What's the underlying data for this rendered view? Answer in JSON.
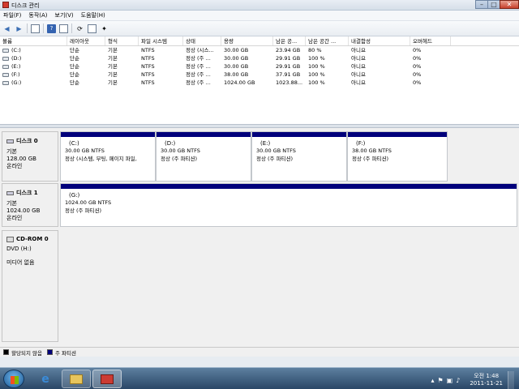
{
  "window": {
    "title": "디스크 관리",
    "min": "–",
    "max": "□",
    "close": "✕"
  },
  "menu": [
    {
      "label": "파일(F)"
    },
    {
      "label": "동작(A)"
    },
    {
      "label": "보기(V)"
    },
    {
      "label": "도움말(H)"
    }
  ],
  "toolbar": {
    "icons": [
      "back-arrow-icon",
      "forward-arrow-icon",
      "properties-icon",
      "help-icon",
      "list-view-icon",
      "refresh-icon",
      "disk-icon",
      "wizard-icon"
    ]
  },
  "volume_list": {
    "columns": [
      "볼륨",
      "레이아웃",
      "형식",
      "파일 시스템",
      "상태",
      "용량",
      "남은 공...",
      "남은 공간 ...",
      "내결함성",
      "오버헤드"
    ],
    "rows": [
      [
        "(C:)",
        "단순",
        "기본",
        "NTFS",
        "정상 (시스...",
        "30.00 GB",
        "23.94 GB",
        "80 %",
        "아니요",
        "0%"
      ],
      [
        "(D:)",
        "단순",
        "기본",
        "NTFS",
        "정상 (주 ...",
        "30.00 GB",
        "29.91 GB",
        "100 %",
        "아니요",
        "0%"
      ],
      [
        "(E:)",
        "단순",
        "기본",
        "NTFS",
        "정상 (주 ...",
        "30.00 GB",
        "29.91 GB",
        "100 %",
        "아니요",
        "0%"
      ],
      [
        "(F:)",
        "단순",
        "기본",
        "NTFS",
        "정상 (주 ...",
        "38.00 GB",
        "37.91 GB",
        "100 %",
        "아니요",
        "0%"
      ],
      [
        "(G:)",
        "단순",
        "기본",
        "NTFS",
        "정상 (주 ...",
        "1024.00 GB",
        "1023.88...",
        "100 %",
        "아니요",
        "0%"
      ]
    ]
  },
  "disks": [
    {
      "name": "디스크 0",
      "type": "기본",
      "size": "128.00 GB",
      "status": "온라인",
      "partitions": [
        {
          "letter": "(C:)",
          "size": "30.00 GB NTFS",
          "status": "정상 (시스템, 부팅, 페이지 파일,"
        },
        {
          "letter": "(D:)",
          "size": "30.00 GB NTFS",
          "status": "정상 (주 파티션)"
        },
        {
          "letter": "(E:)",
          "size": "30.00 GB NTFS",
          "status": "정상 (주 파티션)"
        },
        {
          "letter": "(F:)",
          "size": "38.00 GB NTFS",
          "status": "정상 (주 파티션)"
        }
      ]
    },
    {
      "name": "디스크 1",
      "type": "기본",
      "size": "1024.00 GB",
      "status": "온라인",
      "partitions": [
        {
          "letter": "(G:)",
          "size": "1024.00 GB NTFS",
          "status": "정상 (주 파티션)"
        }
      ]
    },
    {
      "name": "CD-ROM 0",
      "type": "DVD (H:)",
      "size": "",
      "status": "미디어 없음",
      "partitions": []
    }
  ],
  "legend": [
    {
      "label": "할당되지 않음",
      "color": "#000000"
    },
    {
      "label": "주 파티션",
      "color": "#00007b"
    }
  ],
  "taskbar": {
    "clock_time": "오전 1:48",
    "clock_date": "2011-11-21",
    "tray_icons": [
      "flag-icon",
      "network-icon",
      "volume-icon"
    ]
  }
}
